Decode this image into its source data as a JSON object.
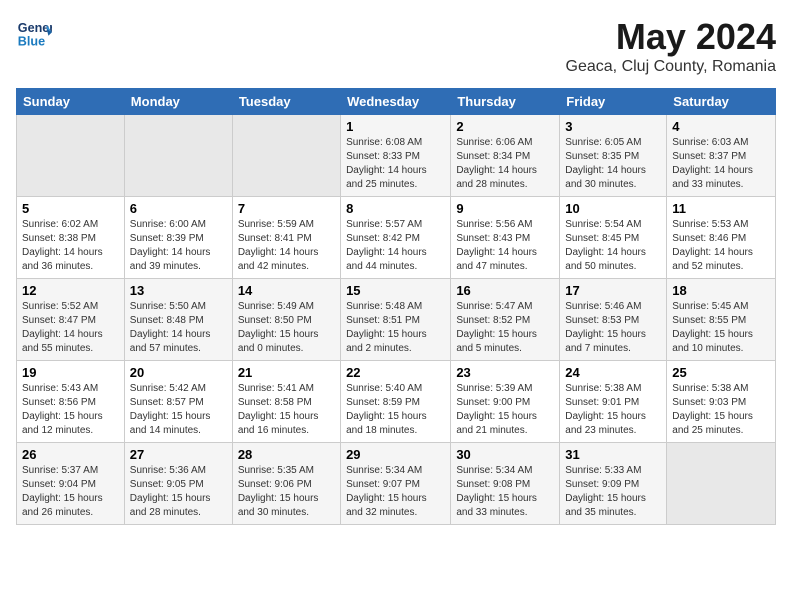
{
  "header": {
    "logo_line1": "General",
    "logo_line2": "Blue",
    "title": "May 2024",
    "subtitle": "Geaca, Cluj County, Romania"
  },
  "weekdays": [
    "Sunday",
    "Monday",
    "Tuesday",
    "Wednesday",
    "Thursday",
    "Friday",
    "Saturday"
  ],
  "weeks": [
    [
      {
        "day": "",
        "info": ""
      },
      {
        "day": "",
        "info": ""
      },
      {
        "day": "",
        "info": ""
      },
      {
        "day": "1",
        "info": "Sunrise: 6:08 AM\nSunset: 8:33 PM\nDaylight: 14 hours\nand 25 minutes."
      },
      {
        "day": "2",
        "info": "Sunrise: 6:06 AM\nSunset: 8:34 PM\nDaylight: 14 hours\nand 28 minutes."
      },
      {
        "day": "3",
        "info": "Sunrise: 6:05 AM\nSunset: 8:35 PM\nDaylight: 14 hours\nand 30 minutes."
      },
      {
        "day": "4",
        "info": "Sunrise: 6:03 AM\nSunset: 8:37 PM\nDaylight: 14 hours\nand 33 minutes."
      }
    ],
    [
      {
        "day": "5",
        "info": "Sunrise: 6:02 AM\nSunset: 8:38 PM\nDaylight: 14 hours\nand 36 minutes."
      },
      {
        "day": "6",
        "info": "Sunrise: 6:00 AM\nSunset: 8:39 PM\nDaylight: 14 hours\nand 39 minutes."
      },
      {
        "day": "7",
        "info": "Sunrise: 5:59 AM\nSunset: 8:41 PM\nDaylight: 14 hours\nand 42 minutes."
      },
      {
        "day": "8",
        "info": "Sunrise: 5:57 AM\nSunset: 8:42 PM\nDaylight: 14 hours\nand 44 minutes."
      },
      {
        "day": "9",
        "info": "Sunrise: 5:56 AM\nSunset: 8:43 PM\nDaylight: 14 hours\nand 47 minutes."
      },
      {
        "day": "10",
        "info": "Sunrise: 5:54 AM\nSunset: 8:45 PM\nDaylight: 14 hours\nand 50 minutes."
      },
      {
        "day": "11",
        "info": "Sunrise: 5:53 AM\nSunset: 8:46 PM\nDaylight: 14 hours\nand 52 minutes."
      }
    ],
    [
      {
        "day": "12",
        "info": "Sunrise: 5:52 AM\nSunset: 8:47 PM\nDaylight: 14 hours\nand 55 minutes."
      },
      {
        "day": "13",
        "info": "Sunrise: 5:50 AM\nSunset: 8:48 PM\nDaylight: 14 hours\nand 57 minutes."
      },
      {
        "day": "14",
        "info": "Sunrise: 5:49 AM\nSunset: 8:50 PM\nDaylight: 15 hours\nand 0 minutes."
      },
      {
        "day": "15",
        "info": "Sunrise: 5:48 AM\nSunset: 8:51 PM\nDaylight: 15 hours\nand 2 minutes."
      },
      {
        "day": "16",
        "info": "Sunrise: 5:47 AM\nSunset: 8:52 PM\nDaylight: 15 hours\nand 5 minutes."
      },
      {
        "day": "17",
        "info": "Sunrise: 5:46 AM\nSunset: 8:53 PM\nDaylight: 15 hours\nand 7 minutes."
      },
      {
        "day": "18",
        "info": "Sunrise: 5:45 AM\nSunset: 8:55 PM\nDaylight: 15 hours\nand 10 minutes."
      }
    ],
    [
      {
        "day": "19",
        "info": "Sunrise: 5:43 AM\nSunset: 8:56 PM\nDaylight: 15 hours\nand 12 minutes."
      },
      {
        "day": "20",
        "info": "Sunrise: 5:42 AM\nSunset: 8:57 PM\nDaylight: 15 hours\nand 14 minutes."
      },
      {
        "day": "21",
        "info": "Sunrise: 5:41 AM\nSunset: 8:58 PM\nDaylight: 15 hours\nand 16 minutes."
      },
      {
        "day": "22",
        "info": "Sunrise: 5:40 AM\nSunset: 8:59 PM\nDaylight: 15 hours\nand 18 minutes."
      },
      {
        "day": "23",
        "info": "Sunrise: 5:39 AM\nSunset: 9:00 PM\nDaylight: 15 hours\nand 21 minutes."
      },
      {
        "day": "24",
        "info": "Sunrise: 5:38 AM\nSunset: 9:01 PM\nDaylight: 15 hours\nand 23 minutes."
      },
      {
        "day": "25",
        "info": "Sunrise: 5:38 AM\nSunset: 9:03 PM\nDaylight: 15 hours\nand 25 minutes."
      }
    ],
    [
      {
        "day": "26",
        "info": "Sunrise: 5:37 AM\nSunset: 9:04 PM\nDaylight: 15 hours\nand 26 minutes."
      },
      {
        "day": "27",
        "info": "Sunrise: 5:36 AM\nSunset: 9:05 PM\nDaylight: 15 hours\nand 28 minutes."
      },
      {
        "day": "28",
        "info": "Sunrise: 5:35 AM\nSunset: 9:06 PM\nDaylight: 15 hours\nand 30 minutes."
      },
      {
        "day": "29",
        "info": "Sunrise: 5:34 AM\nSunset: 9:07 PM\nDaylight: 15 hours\nand 32 minutes."
      },
      {
        "day": "30",
        "info": "Sunrise: 5:34 AM\nSunset: 9:08 PM\nDaylight: 15 hours\nand 33 minutes."
      },
      {
        "day": "31",
        "info": "Sunrise: 5:33 AM\nSunset: 9:09 PM\nDaylight: 15 hours\nand 35 minutes."
      },
      {
        "day": "",
        "info": ""
      }
    ]
  ]
}
